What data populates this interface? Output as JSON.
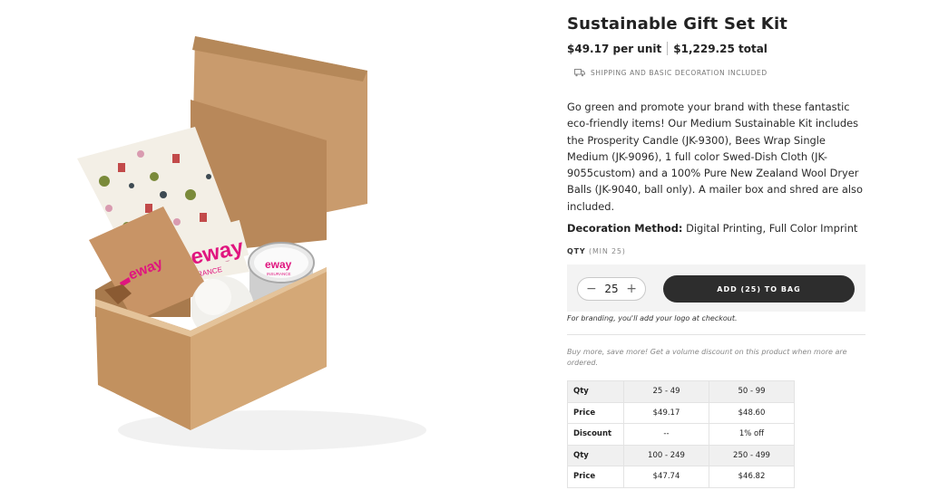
{
  "product": {
    "title": "Sustainable Gift Set Kit",
    "unit_price": "$49.17 per unit",
    "total_price": "$1,229.25 total",
    "shipping_note": "SHIPPING AND BASIC DECORATION INCLUDED",
    "description": "Go green and promote your brand with these fantastic eco-friendly items! Our Medium Sustainable Kit includes the Prosperity Candle (JK-9300), Bees Wrap Single Medium (JK-9096), 1 full color Swed-Dish Cloth (JK-9055custom) and a 100% Pure New Zealand Wool Dryer Balls (JK-9040, ball only). A mailer box and shred are also included.",
    "decoration_label": "Decoration Method:",
    "decoration_value": "Digital Printing, Full Color Imprint"
  },
  "image": {
    "brand_text": "eway",
    "brand_sub": "INSURANCE",
    "card_partial_text": "RANCE"
  },
  "qty": {
    "label": "QTY",
    "min": "(MIN 25)",
    "value": "25",
    "minus": "−",
    "plus": "+",
    "add_button": "ADD (25) TO BAG",
    "branding_note": "For branding, you'll add your logo at checkout."
  },
  "volume": {
    "note": "Buy more, save more! Get a volume discount on this product when more are ordered.",
    "rows": [
      {
        "label": "Qty",
        "a": "25 - 49",
        "b": "50 - 99",
        "shade": true
      },
      {
        "label": "Price",
        "a": "$49.17",
        "b": "$48.60",
        "shade": false
      },
      {
        "label": "Discount",
        "a": "--",
        "b": "1% off",
        "shade": false
      },
      {
        "label": "Qty",
        "a": "100 - 249",
        "b": "250 - 499",
        "shade": true
      },
      {
        "label": "Price",
        "a": "$47.74",
        "b": "$46.82",
        "shade": false
      }
    ]
  },
  "colors": {
    "button_bg": "#2d2d2d",
    "kraft": "#c8996a",
    "brand_magenta": "#e0157f"
  }
}
